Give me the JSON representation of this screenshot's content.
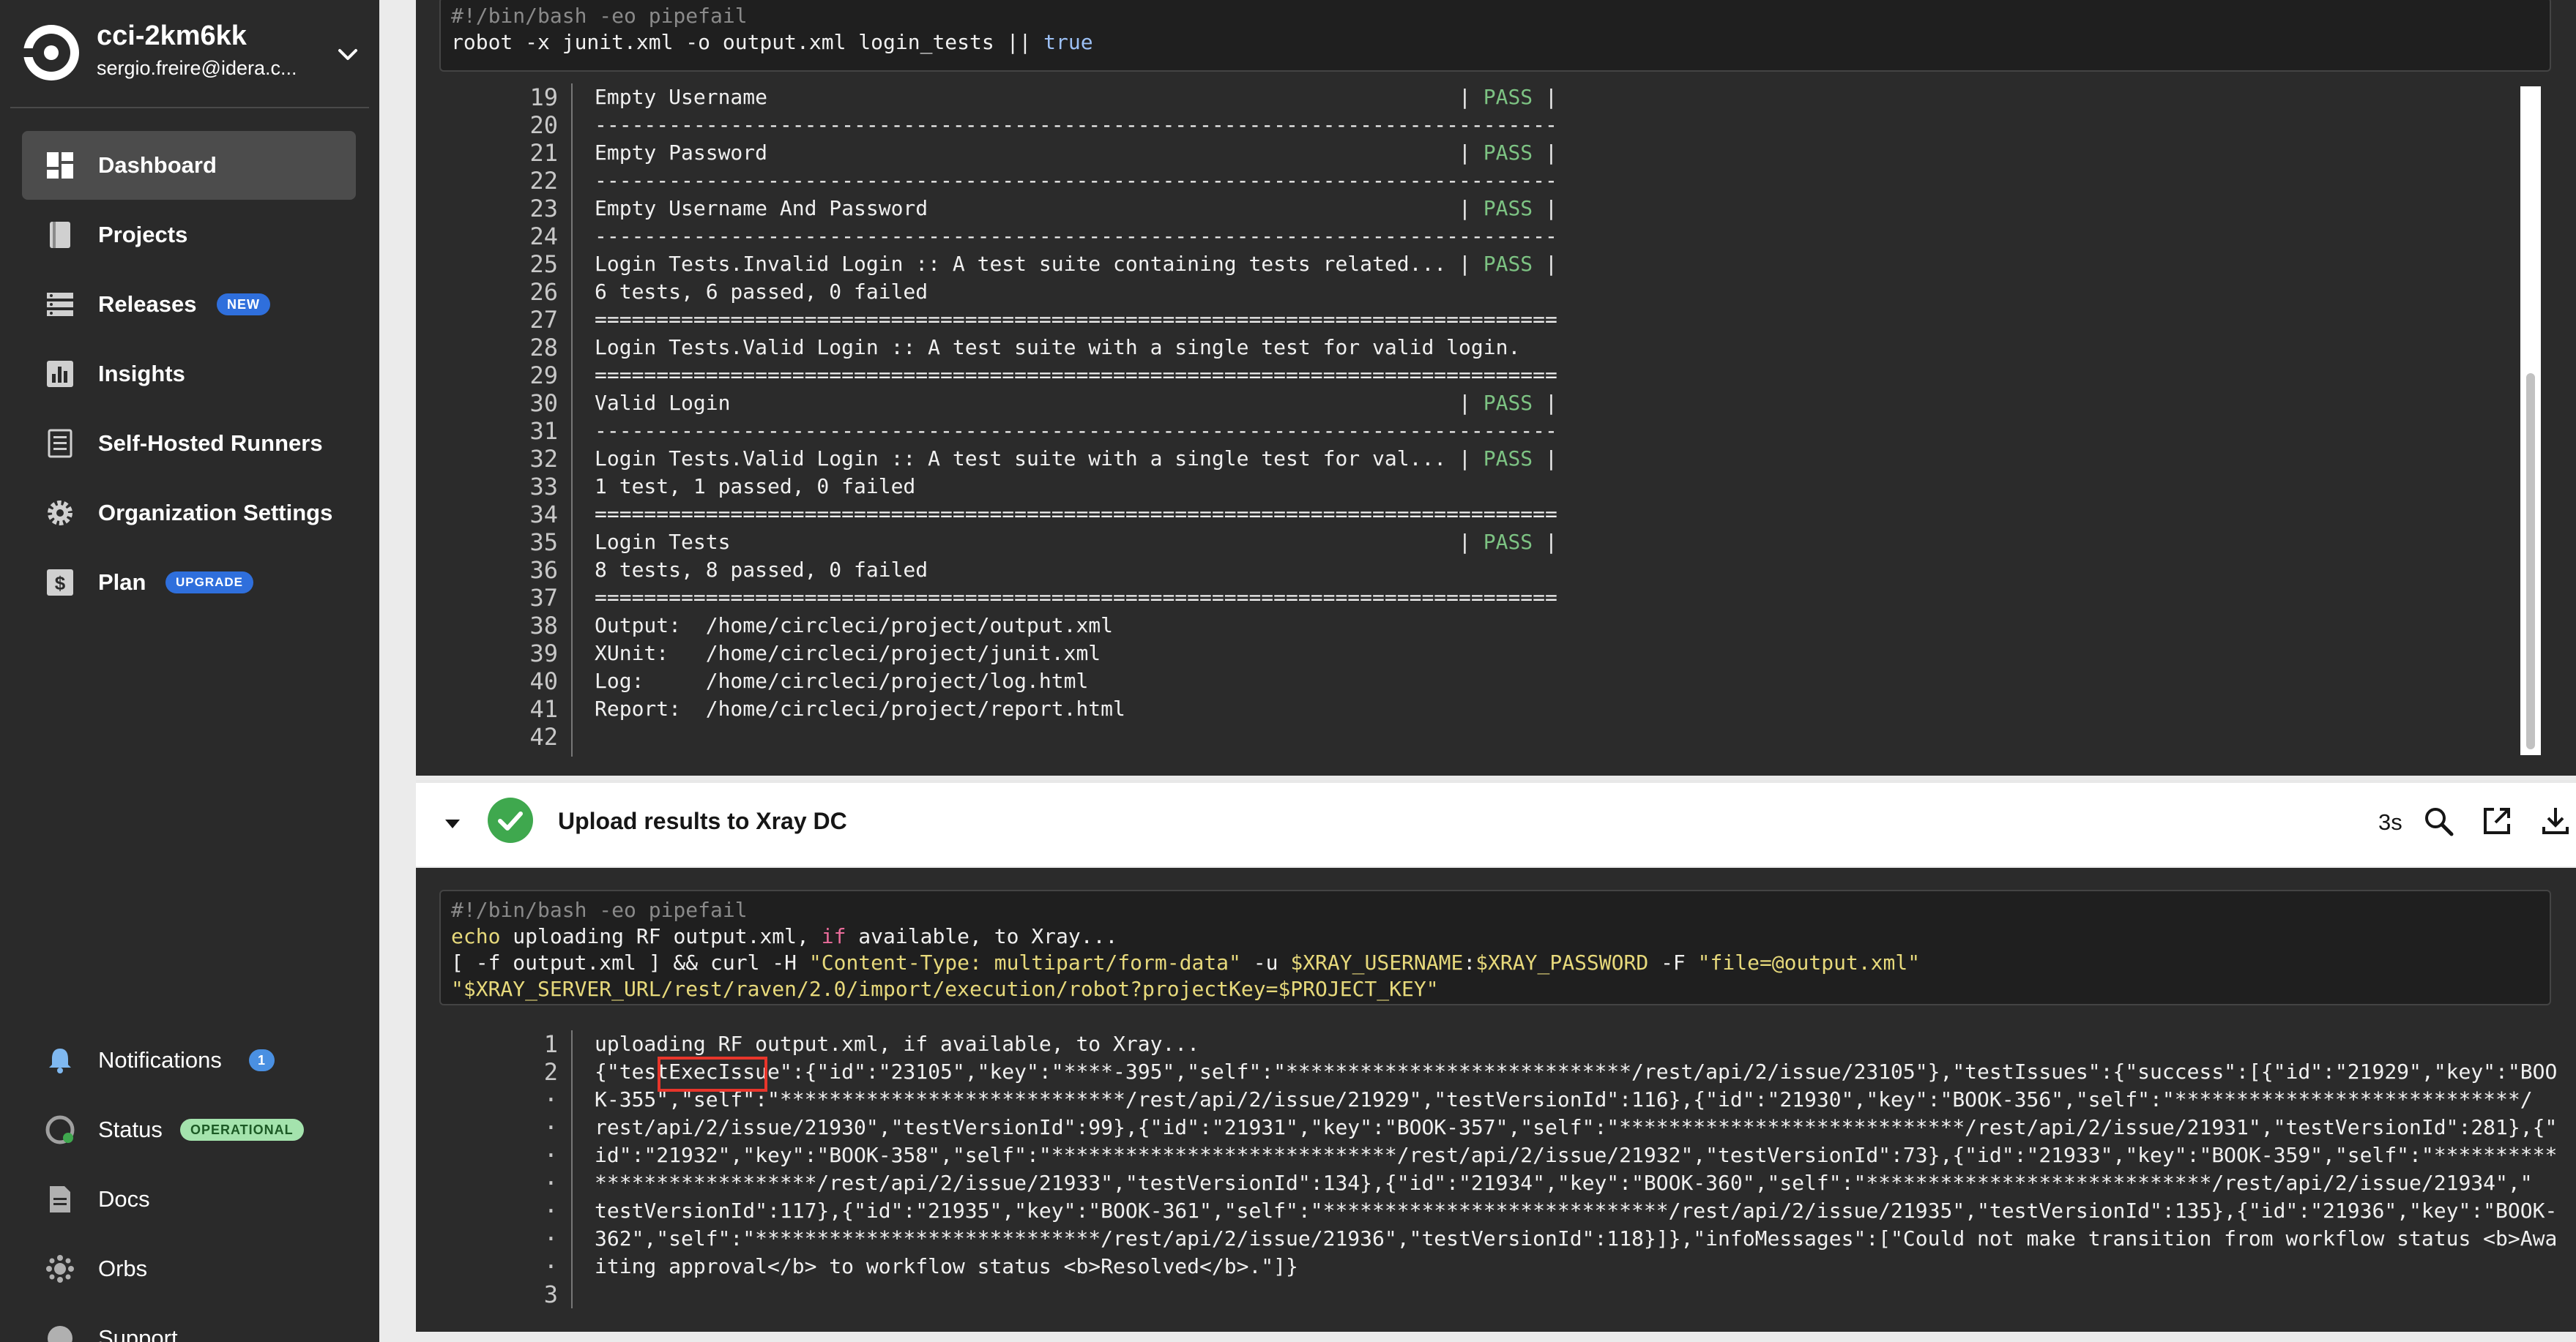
{
  "sidebar": {
    "org_name": "cci-2km6kk",
    "org_email": "sergio.freire@idera.c...",
    "items": [
      {
        "label": "Dashboard",
        "icon": "dashboard-icon",
        "active": true
      },
      {
        "label": "Projects",
        "icon": "book-icon"
      },
      {
        "label": "Releases",
        "icon": "releases-icon",
        "badge": "NEW"
      },
      {
        "label": "Insights",
        "icon": "bar-chart-icon"
      },
      {
        "label": "Self-Hosted Runners",
        "icon": "runner-icon"
      },
      {
        "label": "Organization Settings",
        "icon": "gear-icon"
      },
      {
        "label": "Plan",
        "icon": "dollar-icon",
        "badge": "UPGRADE"
      }
    ],
    "bottom_items": [
      {
        "label": "Notifications",
        "icon": "bell-icon",
        "badge": "1"
      },
      {
        "label": "Status",
        "icon": "status-icon",
        "badge": "OPERATIONAL"
      },
      {
        "label": "Docs",
        "icon": "doc-icon"
      },
      {
        "label": "Orbs",
        "icon": "orbs-icon"
      },
      {
        "label": "Support",
        "icon": "support-icon"
      }
    ]
  },
  "run_step": {
    "command_line1": "#!/bin/bash -eo pipefail",
    "command_line2_prefix": "robot -x junit.xml -o output.xml login_tests || ",
    "command_line2_keyword": "true",
    "output_lines": [
      {
        "n": "19",
        "text": "Empty Username                                                        | ",
        "status": "PASS",
        "end": " |"
      },
      {
        "n": "20",
        "text": "------------------------------------------------------------------------------"
      },
      {
        "n": "21",
        "text": "Empty Password                                                        | ",
        "status": "PASS",
        "end": " |"
      },
      {
        "n": "22",
        "text": "------------------------------------------------------------------------------"
      },
      {
        "n": "23",
        "text": "Empty Username And Password                                           | ",
        "status": "PASS",
        "end": " |"
      },
      {
        "n": "24",
        "text": "------------------------------------------------------------------------------"
      },
      {
        "n": "25",
        "text": "Login Tests.Invalid Login :: A test suite containing tests related... | ",
        "status": "PASS",
        "end": " |"
      },
      {
        "n": "26",
        "text": "6 tests, 6 passed, 0 failed"
      },
      {
        "n": "27",
        "text": "=============================================================================="
      },
      {
        "n": "28",
        "text": "Login Tests.Valid Login :: A test suite with a single test for valid login."
      },
      {
        "n": "29",
        "text": "=============================================================================="
      },
      {
        "n": "30",
        "text": "Valid Login                                                           | ",
        "status": "PASS",
        "end": " |"
      },
      {
        "n": "31",
        "text": "------------------------------------------------------------------------------"
      },
      {
        "n": "32",
        "text": "Login Tests.Valid Login :: A test suite with a single test for val... | ",
        "status": "PASS",
        "end": " |"
      },
      {
        "n": "33",
        "text": "1 test, 1 passed, 0 failed"
      },
      {
        "n": "34",
        "text": "=============================================================================="
      },
      {
        "n": "35",
        "text": "Login Tests                                                           | ",
        "status": "PASS",
        "end": " |"
      },
      {
        "n": "36",
        "text": "8 tests, 8 passed, 0 failed"
      },
      {
        "n": "37",
        "text": "=============================================================================="
      },
      {
        "n": "38",
        "text": "Output:  /home/circleci/project/output.xml"
      },
      {
        "n": "39",
        "text": "XUnit:   /home/circleci/project/junit.xml"
      },
      {
        "n": "40",
        "text": "Log:     /home/circleci/project/log.html"
      },
      {
        "n": "41",
        "text": "Report:  /home/circleci/project/report.html"
      },
      {
        "n": "42",
        "text": ""
      }
    ]
  },
  "upload_step": {
    "title": "Upload results to Xray DC",
    "duration": "3s",
    "command": {
      "line1": "#!/bin/bash -eo pipefail",
      "line2_a": "echo",
      "line2_b": " uploading RF output.xml, ",
      "line2_c": "if",
      "line2_d": " available, to Xray...",
      "line3_a": "[ -f output.xml ] && curl -H ",
      "line3_b": "\"Content-Type: multipart/form-data\"",
      "line3_c": " -u ",
      "line3_d": "$XRAY_USERNAME",
      "line3_e": ":",
      "line3_f": "$XRAY_PASSWORD",
      "line3_g": " -F ",
      "line3_h": "\"file=@output.xml\"",
      "line4": "\"$XRAY_SERVER_URL/rest/raven/2.0/import/execution/robot?projectKey=$PROJECT_KEY\""
    },
    "line_numbers": [
      "1",
      "2",
      "·",
      "·",
      "·",
      "·",
      "·",
      "·",
      "·",
      "3"
    ],
    "output_lines": [
      "uploading RF output.xml, if available, to Xray...",
      "{\"testExecIssue\":{\"id\":\"23105\",\"key\":\"****-395\",\"self\":\"****************************/rest/api/2/issue/23105\"},\"testIssues\":{\"success\":[{\"id\":\"21929\",\"key\":\"BOO",
      "K-355\",\"self\":\"****************************/rest/api/2/issue/21929\",\"testVersionId\":116},{\"id\":\"21930\",\"key\":\"BOOK-356\",\"self\":\"****************************/",
      "rest/api/2/issue/21930\",\"testVersionId\":99},{\"id\":\"21931\",\"key\":\"BOOK-357\",\"self\":\"****************************/rest/api/2/issue/21931\",\"testVersionId\":281},{\"",
      "id\":\"21932\",\"key\":\"BOOK-358\",\"self\":\"****************************/rest/api/2/issue/21932\",\"testVersionId\":73},{\"id\":\"21933\",\"key\":\"BOOK-359\",\"self\":\"**********",
      "******************/rest/api/2/issue/21933\",\"testVersionId\":134},{\"id\":\"21934\",\"key\":\"BOOK-360\",\"self\":\"****************************/rest/api/2/issue/21934\",\"",
      "testVersionId\":117},{\"id\":\"21935\",\"key\":\"BOOK-361\",\"self\":\"****************************/rest/api/2/issue/21935\",\"testVersionId\":135},{\"id\":\"21936\",\"key\":\"BOOK-",
      "362\",\"self\":\"****************************/rest/api/2/issue/21936\",\"testVersionId\":118}]},\"infoMessages\":[\"Could not make transition from workflow status <b>Awa",
      "iting approval</b> to workflow status <b>Resolved</b>.\"]}",
      ""
    ]
  },
  "colors": {
    "sidebar_bg": "#2a2a2a",
    "terminal_bg": "#2b2b2b",
    "pass": "#7dc383",
    "success": "#3fa84e",
    "highlight": "#e8352b"
  }
}
